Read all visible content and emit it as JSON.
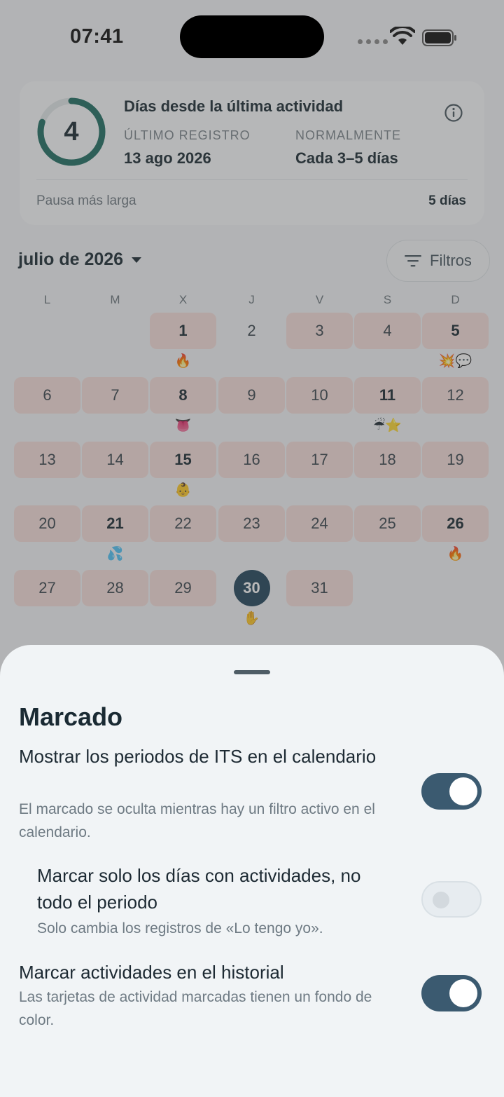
{
  "status_bar": {
    "time": "07:41"
  },
  "summary": {
    "days_count": "4",
    "ring_progress": 0.8,
    "title": "Días desde la última actividad",
    "last_label": "ÚLTIMO REGISTRO",
    "last_value": "13 ago 2026",
    "normal_label": "NORMALMENTE",
    "normal_value": "Cada 3–5 días",
    "pause_label": "Pausa más larga",
    "pause_value": "5 días"
  },
  "calendar": {
    "month_label": "julio de 2026",
    "filters_label": "Filtros",
    "weekdays": [
      "L",
      "M",
      "X",
      "J",
      "V",
      "S",
      "D"
    ],
    "days": [
      {
        "n": "1",
        "col": 2,
        "row": 0,
        "marked": true,
        "bold": true,
        "emoji": "🔥"
      },
      {
        "n": "2",
        "col": 3,
        "row": 0,
        "marked": false,
        "bold": false
      },
      {
        "n": "3",
        "col": 4,
        "row": 0,
        "marked": true,
        "bold": false
      },
      {
        "n": "4",
        "col": 5,
        "row": 0,
        "marked": true,
        "bold": false
      },
      {
        "n": "5",
        "col": 6,
        "row": 0,
        "marked": true,
        "bold": true,
        "emoji": "💥💬"
      },
      {
        "n": "6",
        "col": 0,
        "row": 1,
        "marked": true,
        "bold": false
      },
      {
        "n": "7",
        "col": 1,
        "row": 1,
        "marked": true,
        "bold": false
      },
      {
        "n": "8",
        "col": 2,
        "row": 1,
        "marked": true,
        "bold": true,
        "emoji": "👅"
      },
      {
        "n": "9",
        "col": 3,
        "row": 1,
        "marked": true,
        "bold": false
      },
      {
        "n": "10",
        "col": 4,
        "row": 1,
        "marked": true,
        "bold": false
      },
      {
        "n": "11",
        "col": 5,
        "row": 1,
        "marked": true,
        "bold": true,
        "emoji": "☔⭐"
      },
      {
        "n": "12",
        "col": 6,
        "row": 1,
        "marked": true,
        "bold": false
      },
      {
        "n": "13",
        "col": 0,
        "row": 2,
        "marked": true,
        "bold": false
      },
      {
        "n": "14",
        "col": 1,
        "row": 2,
        "marked": true,
        "bold": false
      },
      {
        "n": "15",
        "col": 2,
        "row": 2,
        "marked": true,
        "bold": true,
        "emoji": "👶"
      },
      {
        "n": "16",
        "col": 3,
        "row": 2,
        "marked": true,
        "bold": false
      },
      {
        "n": "17",
        "col": 4,
        "row": 2,
        "marked": true,
        "bold": false
      },
      {
        "n": "18",
        "col": 5,
        "row": 2,
        "marked": true,
        "bold": false
      },
      {
        "n": "19",
        "col": 6,
        "row": 2,
        "marked": true,
        "bold": false
      },
      {
        "n": "20",
        "col": 0,
        "row": 3,
        "marked": true,
        "bold": false
      },
      {
        "n": "21",
        "col": 1,
        "row": 3,
        "marked": true,
        "bold": true,
        "emoji": "💦"
      },
      {
        "n": "22",
        "col": 2,
        "row": 3,
        "marked": true,
        "bold": false
      },
      {
        "n": "23",
        "col": 3,
        "row": 3,
        "marked": true,
        "bold": false
      },
      {
        "n": "24",
        "col": 4,
        "row": 3,
        "marked": true,
        "bold": false
      },
      {
        "n": "25",
        "col": 5,
        "row": 3,
        "marked": true,
        "bold": false
      },
      {
        "n": "26",
        "col": 6,
        "row": 3,
        "marked": true,
        "bold": true,
        "emoji": "🔥"
      },
      {
        "n": "27",
        "col": 0,
        "row": 4,
        "marked": true,
        "bold": false
      },
      {
        "n": "28",
        "col": 1,
        "row": 4,
        "marked": true,
        "bold": false
      },
      {
        "n": "29",
        "col": 2,
        "row": 4,
        "marked": true,
        "bold": false
      },
      {
        "n": "30",
        "col": 3,
        "row": 4,
        "marked": true,
        "bold": true,
        "today": true,
        "emoji": "✋"
      },
      {
        "n": "31",
        "col": 4,
        "row": 4,
        "marked": true,
        "bold": false
      }
    ]
  },
  "sheet": {
    "title": "Marcado",
    "options": [
      {
        "title": "Mostrar los periodos de ITS en el calendario",
        "description": "El marcado se oculta mientras hay un filtro activo en el calendario.",
        "enabled": true
      },
      {
        "title": "Marcar solo los días con actividades, no todo el periodo",
        "description": "Solo cambia los registros de «Lo tengo yo».",
        "enabled": false
      },
      {
        "title": "Marcar actividades en el historial",
        "description": "Las tarjetas de actividad marcadas tienen un fondo de color.",
        "enabled": true
      }
    ]
  },
  "colors": {
    "ring": "#1f6f63",
    "marked_day": "#f7dfdb",
    "today": "#23465c",
    "toggle_on": "#3b5a70"
  }
}
